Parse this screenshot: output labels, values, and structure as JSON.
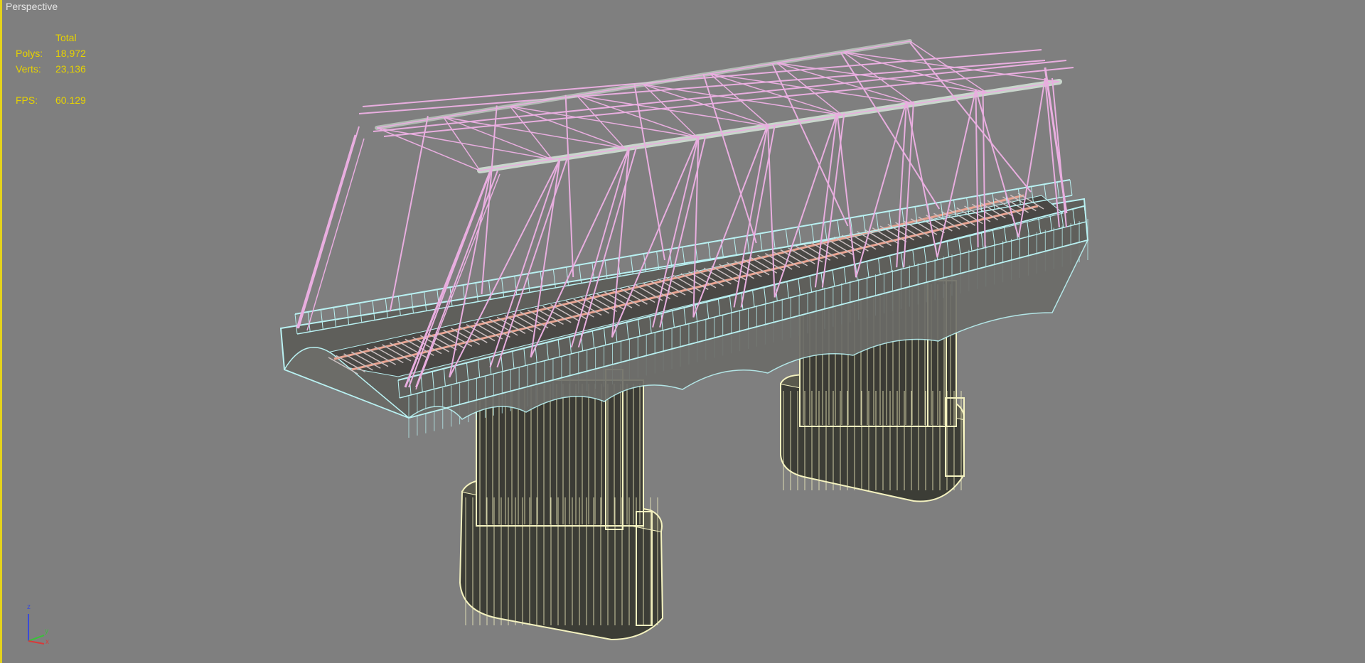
{
  "viewport": {
    "label": "Perspective",
    "stats": {
      "header": "Total",
      "rows": [
        {
          "label": "Polys:",
          "value": "18,972"
        },
        {
          "label": "Verts:",
          "value": "23,136"
        }
      ],
      "fps_label": "FPS:",
      "fps_value": "60.129"
    },
    "axis_gizmo": {
      "z": "z",
      "y": "y",
      "x": "x"
    },
    "colors": {
      "background": "#7f7f7f",
      "border": "#e4d21c",
      "stats_text": "#e6d200",
      "truss_wire": "#e9aee0",
      "deck_wire": "#b9f1f2",
      "pier_wire": "#f4f2c0",
      "rail_wire": "#e8a391"
    },
    "scene_object": "truss-railway-bridge-wireframe"
  }
}
